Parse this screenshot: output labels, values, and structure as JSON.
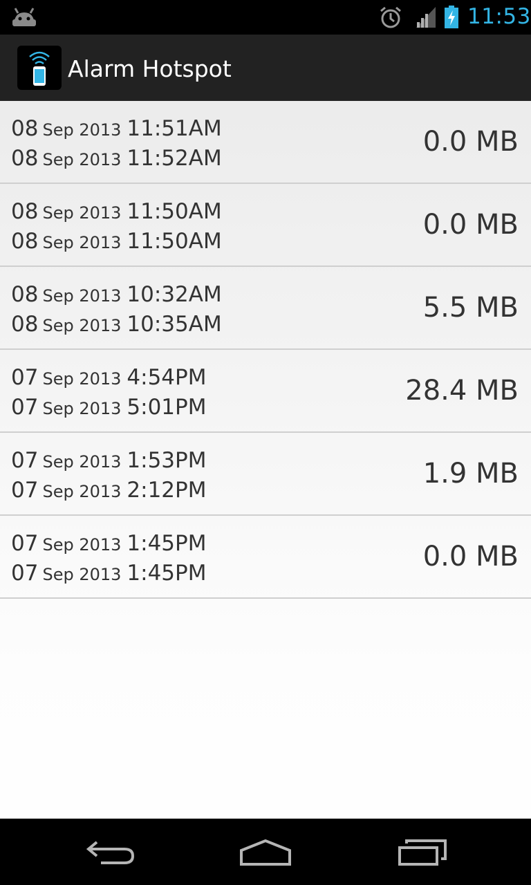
{
  "status_bar": {
    "time": "11:53",
    "icons": [
      "android-icon",
      "alarm-clock-icon",
      "signal-icon",
      "battery-charging-icon"
    ]
  },
  "action_bar": {
    "title": "Alarm Hotspot",
    "icon": "hotspot-phone-icon"
  },
  "sessions": [
    {
      "start_day": "08",
      "start_month_year": "Sep 2013",
      "start_time": "11:51AM",
      "end_day": "08",
      "end_month_year": "Sep 2013",
      "end_time": "11:52AM",
      "size": "0.0 MB"
    },
    {
      "start_day": "08",
      "start_month_year": "Sep 2013",
      "start_time": "11:50AM",
      "end_day": "08",
      "end_month_year": "Sep 2013",
      "end_time": "11:50AM",
      "size": "0.0 MB"
    },
    {
      "start_day": "08",
      "start_month_year": "Sep 2013",
      "start_time": "10:32AM",
      "end_day": "08",
      "end_month_year": "Sep 2013",
      "end_time": "10:35AM",
      "size": "5.5 MB"
    },
    {
      "start_day": "07",
      "start_month_year": "Sep 2013",
      "start_time": "4:54PM",
      "end_day": "07",
      "end_month_year": "Sep 2013",
      "end_time": "5:01PM",
      "size": "28.4 MB"
    },
    {
      "start_day": "07",
      "start_month_year": "Sep 2013",
      "start_time": "1:53PM",
      "end_day": "07",
      "end_month_year": "Sep 2013",
      "end_time": "2:12PM",
      "size": "1.9 MB"
    },
    {
      "start_day": "07",
      "start_month_year": "Sep 2013",
      "start_time": "1:45PM",
      "end_day": "07",
      "end_month_year": "Sep 2013",
      "end_time": "1:45PM",
      "size": "0.0 MB"
    }
  ],
  "nav_bar": {
    "buttons": [
      "back-icon",
      "home-icon",
      "recent-apps-icon"
    ]
  },
  "colors": {
    "status_time": "#33b5e5",
    "action_bar": "#222222",
    "text": "#333333",
    "divider": "#cfcfcf"
  }
}
